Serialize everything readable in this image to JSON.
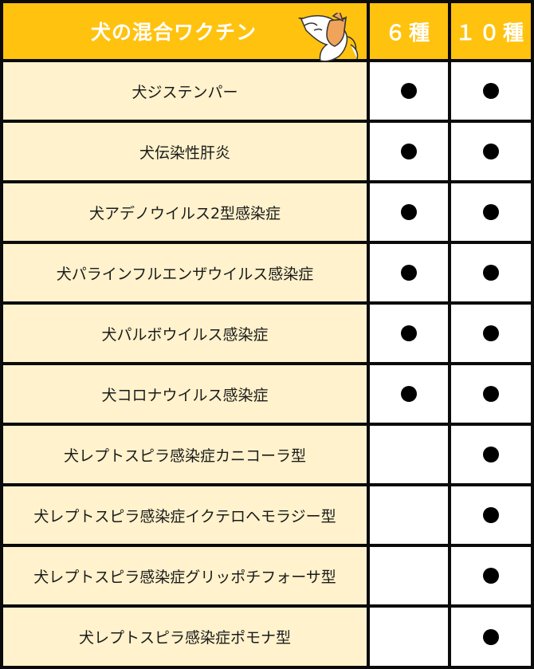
{
  "header": {
    "title": "犬の混合ワクチン",
    "col_6": "６種",
    "col_10": "１０種"
  },
  "rows": [
    {
      "name": "犬ジステンパー",
      "in_6": true,
      "in_10": true
    },
    {
      "name": "犬伝染性肝炎",
      "in_6": true,
      "in_10": true
    },
    {
      "name": "犬アデノウイルス2型感染症",
      "in_6": true,
      "in_10": true
    },
    {
      "name": "犬パラインフルエンザウイルス感染症",
      "in_6": true,
      "in_10": true
    },
    {
      "name": "犬パルボウイルス感染症",
      "in_6": true,
      "in_10": true
    },
    {
      "name": "犬コロナウイルス感染症",
      "in_6": true,
      "in_10": true
    },
    {
      "name": "犬レプトスピラ感染症カニコーラ型",
      "in_6": false,
      "in_10": true
    },
    {
      "name": "犬レプトスピラ感染症イクテロヘモラジー型",
      "in_6": false,
      "in_10": true
    },
    {
      "name": "犬レプトスピラ感染症グリッポチフォーサ型",
      "in_6": false,
      "in_10": true
    },
    {
      "name": "犬レプトスピラ感染症ポモナ型",
      "in_6": false,
      "in_10": true
    }
  ],
  "colors": {
    "header_bg": "#ffc20e",
    "name_bg": "#fff2cc",
    "mark_bg": "#ffffff",
    "grid": "#0b0b0b",
    "dot": "#000000"
  },
  "icons": {
    "mascot": "fox-icon",
    "mark": "filled-circle-icon"
  }
}
